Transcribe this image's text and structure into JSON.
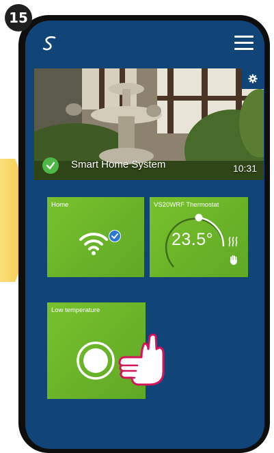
{
  "step": {
    "number": "15"
  },
  "app": {
    "logo_icon": "salus-logo-icon",
    "menu_icon": "hamburger-menu-icon"
  },
  "hero": {
    "title": "Smart Home System",
    "time": "10:31",
    "status": "connected",
    "settings_icon": "gear-icon"
  },
  "tiles": {
    "home": {
      "label": "Home",
      "icon": "wifi-icon",
      "status_icon": "check-badge-icon"
    },
    "thermostat": {
      "label": "VS20WRF Thermostat",
      "temperature": "23.5°",
      "icons": [
        "heating-icon",
        "manual-hand-icon"
      ]
    },
    "low_temperature": {
      "label": "Low temperature",
      "icon": "toggle-button-icon"
    }
  },
  "colors": {
    "screen": "#114477",
    "tile": "#6bb52a",
    "check": "#4db848",
    "badge_blue": "#2b78d2",
    "hint_arrow": "#f6c945",
    "hand_outline": "#d4145a"
  }
}
